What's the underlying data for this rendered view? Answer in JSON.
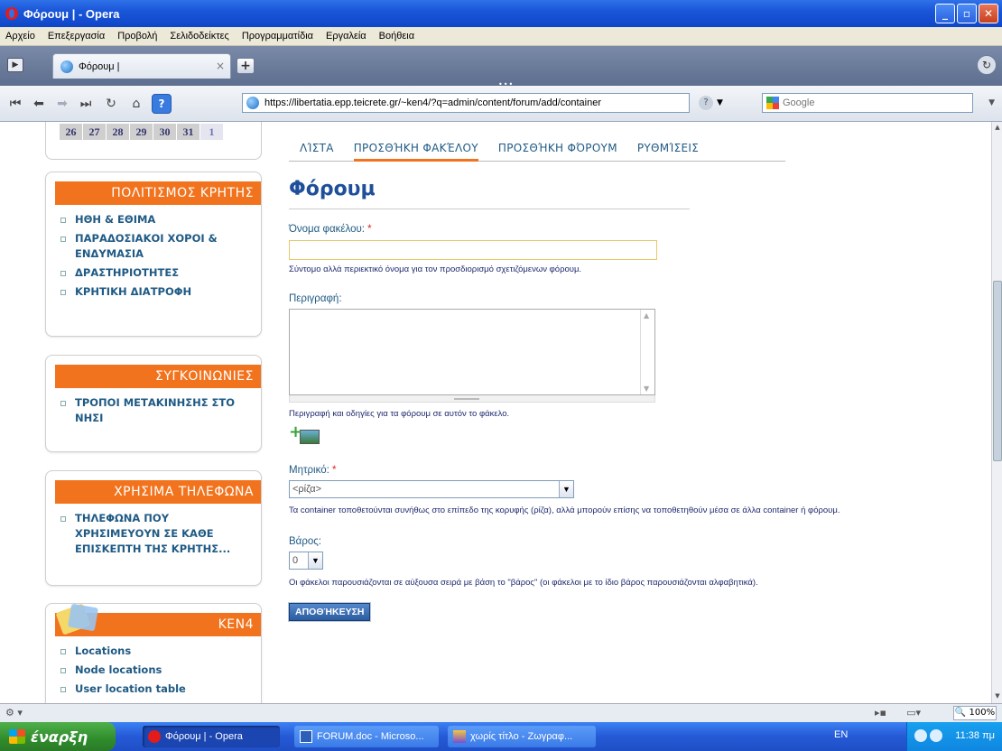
{
  "window": {
    "title": "Φόρουμ | - Opera",
    "buttons": {
      "minimize": "_",
      "maximize": "▫",
      "close": "✕"
    }
  },
  "menubar": [
    "Αρχείο",
    "Επεξεργασία",
    "Προβολή",
    "Σελιδοδείκτες",
    "Προγραμματίδια",
    "Εργαλεία",
    "Βοήθεια"
  ],
  "tabs": {
    "active_title": "Φόρουμ |",
    "close_glyph": "×",
    "new_tab_glyph": "+"
  },
  "navbar": {
    "url": "https://libertatia.epp.teicrete.gr/~ken4/?q=admin/content/forum/add/container",
    "search_placeholder": "Google"
  },
  "sidebar": {
    "calendar_days": [
      "26",
      "27",
      "28",
      "29",
      "30",
      "31",
      "1"
    ],
    "blocks": [
      {
        "title": "ΠΟΛΙΤΙΣΜΟΣ ΚΡΗΤΗΣ",
        "items": [
          "ΗΘΗ & ΕΘΙΜΑ",
          "ΠΑΡΑΔΟΣΙΑΚΟΙ ΧΟΡΟΙ & ΕΝΔΥΜΑΣΙΑ",
          "ΔΡΑΣΤΗΡΙΟΤΗΤΕΣ",
          "ΚΡΗΤΙΚΗ ΔΙΑΤΡΟΦΗ"
        ]
      },
      {
        "title": "ΣΥΓΚΟΙΝΩΝΙΕΣ",
        "items": [
          "ΤΡΟΠΟΙ ΜΕΤΑΚΙΝΗΣΗΣ ΣΤΟ ΝΗΣΙ"
        ]
      },
      {
        "title": "ΧΡΗΣΙΜΑ ΤΗΛΕΦΩΝΑ",
        "items": [
          "ΤΗΛΕΦΩΝΑ ΠΟΥ ΧΡΗΣΙΜΕΥΟΥΝ ΣΕ ΚΑΘΕ ΕΠΙΣΚΕΠΤΗ ΤΗΣ ΚΡΗΤΗΣ..."
        ]
      },
      {
        "title": "KEN4",
        "items": [
          "Locations",
          "Node locations",
          "User location table"
        ]
      }
    ]
  },
  "main": {
    "tabs": [
      "ΛΊΣΤΑ",
      "ΠΡΟΣΘΉΚΗ ΦΑΚΈΛΟΥ",
      "ΠΡΟΣΘΉΚΗ ΦΌΡΟΥΜ",
      "ΡΥΘΜΊΣΕΙΣ"
    ],
    "active_tab_index": 1,
    "page_title": "Φόρουμ",
    "name_label": "Όνομα φακέλου:",
    "required_mark": "*",
    "name_value": "",
    "name_help": "Σύντομο αλλά περιεκτικό όνομα για τον προσδιορισμό σχετιζόμενων φόρουμ.",
    "description_label": "Περιγραφή:",
    "description_value": "",
    "description_help": "Περιγραφή και οδηγίες για τα φόρουμ σε αυτόν το φάκελο.",
    "parent_label": "Μητρικό:",
    "parent_value": "<ρίζα>",
    "parent_help": "Τα container τοποθετούνται συνήθως στο επίπεδο της κορυφής (ρίζα), αλλά μπορούν επίσης να τοποθετηθούν μέσα σε άλλα container ή φόρουμ.",
    "weight_label": "Βάρος:",
    "weight_value": "0",
    "weight_help": "Οι φάκελοι παρουσιάζονται σε αύξουσα σειρά με βάση το \"βάρος\" (οι φάκελοι με το ίδιο βάρος παρουσιάζονται αλφαβητικά).",
    "save_label": "ΑΠΟΘΉΚΕΥΣΗ"
  },
  "statusbar": {
    "zoom": "100%"
  },
  "taskbar": {
    "start_label": "έναρξη",
    "tasks": [
      "Φόρουμ | - Opera",
      "FORUM.doc - Microso...",
      "χωρίς τίτλο - Ζωγραφ..."
    ],
    "language": "EN",
    "clock": "11:38 πμ"
  },
  "colors": {
    "accent_orange": "#f2731d",
    "link_blue": "#1f5a84",
    "title_blue": "#1f4f9a",
    "required_red": "#e0231c"
  }
}
